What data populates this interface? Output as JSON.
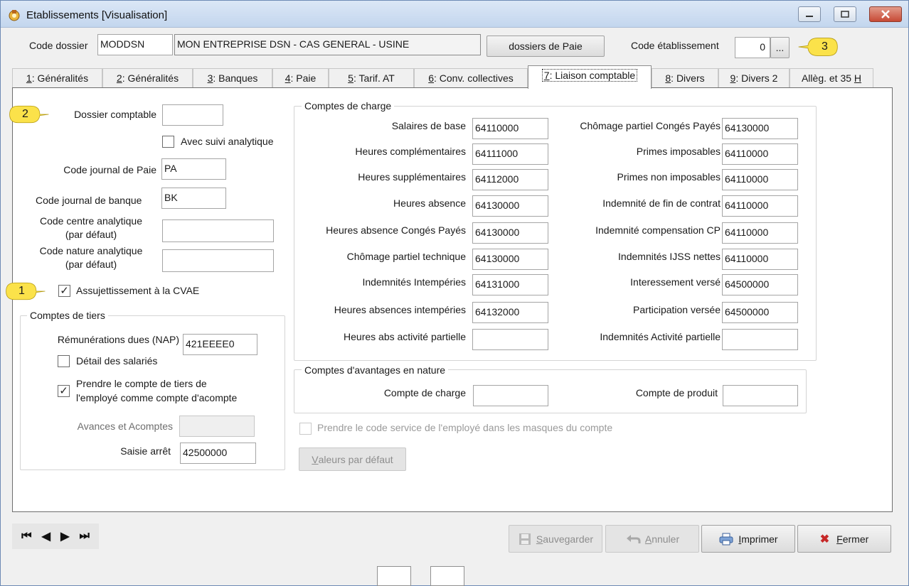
{
  "window": {
    "title": "Etablissements  [Visualisation]"
  },
  "header": {
    "code_dossier_label": "Code dossier",
    "code_dossier_value": "MODDSN",
    "dossier_name": "MON ENTREPRISE DSN - CAS GENERAL - USINE",
    "dossiers_paie_button": "dossiers de Paie",
    "code_etab_label": "Code établissement",
    "code_etab_value": "0",
    "ellipsis_button": "..."
  },
  "tabs": [
    {
      "key": "1",
      "label": ": Généralités"
    },
    {
      "key": "2",
      "label": ": Généralités"
    },
    {
      "key": "3",
      "label": ": Banques"
    },
    {
      "key": "4",
      "label": ": Paie"
    },
    {
      "key": "5",
      "label": ": Tarif. AT"
    },
    {
      "key": "6",
      "label": ": Conv. collectives"
    },
    {
      "key": "7",
      "label": ": Liaison comptable"
    },
    {
      "key": "8",
      "label": ": Divers"
    },
    {
      "key": "9",
      "label": ": Divers 2"
    },
    {
      "key": "H",
      "label": "Allèg. et 35 "
    }
  ],
  "left": {
    "dossier_comptable_label": "Dossier comptable",
    "dossier_comptable_value": "",
    "suivi_analytique_label": "Avec suivi analytique",
    "suivi_analytique_checked": false,
    "journal_paie_label": "Code journal de Paie",
    "journal_paie_value": "PA",
    "journal_banque_label": "Code journal de banque",
    "journal_banque_value": "BK",
    "centre_analytique_label_1": "Code centre analytique",
    "centre_analytique_label_2": "(par défaut)",
    "centre_analytique_value": "",
    "nature_analytique_label_1": "Code nature analytique",
    "nature_analytique_label_2": "(par défaut)",
    "nature_analytique_value": "",
    "cvae_label": "Assujettissement à la CVAE",
    "cvae_checked": true
  },
  "tiers": {
    "title": "Comptes de tiers",
    "remun_label": "Rémunérations dues (NAP)",
    "remun_value": "421EEEE0",
    "detail_label": "Détail des salariés",
    "detail_checked": false,
    "prendre_label_1": "Prendre le compte de tiers de",
    "prendre_label_2": "l'employé comme compte d'acompte",
    "prendre_checked": true,
    "avances_label": "Avances et Acomptes",
    "avances_value": "",
    "saisie_label": "Saisie arrêt",
    "saisie_value": "42500000"
  },
  "charges": {
    "title": "Comptes de charge",
    "left_rows": [
      {
        "label": "Salaires de base",
        "value": "64110000"
      },
      {
        "label": "Heures complémentaires",
        "value": "64111000"
      },
      {
        "label": "Heures supplémentaires",
        "value": "64112000"
      },
      {
        "label": "Heures absence",
        "value": "64130000"
      },
      {
        "label": "Heures absence Congés Payés",
        "value": "64130000"
      },
      {
        "label": "Chômage partiel technique",
        "value": "64130000"
      },
      {
        "label": "Indemnités Intempéries",
        "value": "64131000"
      },
      {
        "label": "Heures absences intempéries",
        "value": "64132000"
      },
      {
        "label": "Heures abs activité partielle",
        "value": ""
      }
    ],
    "right_rows": [
      {
        "label": "Chômage partiel Congés Payés",
        "value": "64130000"
      },
      {
        "label": "Primes imposables",
        "value": "64110000"
      },
      {
        "label": "Primes non imposables",
        "value": "64110000"
      },
      {
        "label": "Indemnité de fin de contrat",
        "value": "64110000"
      },
      {
        "label": "Indemnité compensation CP",
        "value": "64110000"
      },
      {
        "label": "Indemnités IJSS nettes",
        "value": "64110000"
      },
      {
        "label": "Interessement versé",
        "value": "64500000"
      },
      {
        "label": "Participation versée",
        "value": "64500000"
      },
      {
        "label": "Indemnités Activité partielle",
        "value": ""
      }
    ]
  },
  "avantages": {
    "title": "Comptes d'avantages en nature",
    "charge_label": "Compte de charge",
    "charge_value": "",
    "produit_label": "Compte de produit",
    "produit_value": ""
  },
  "service_checkbox_label": "Prendre le code service de l'employé dans les masques du compte",
  "defaults_button": {
    "key": "V",
    "rest": "aleurs par défaut"
  },
  "footer": {
    "save": {
      "key": "S",
      "rest": "auvegarder"
    },
    "cancel": {
      "key": "A",
      "rest": "nnuler"
    },
    "print": {
      "key": "I",
      "rest": "mprimer"
    },
    "close": {
      "key": "F",
      "rest": "ermer"
    }
  },
  "callouts": [
    "1",
    "2",
    "3"
  ],
  "colors": {
    "callout": "#fbe24a",
    "close_x": "#c62828",
    "active_border": "#8d8d8d"
  }
}
